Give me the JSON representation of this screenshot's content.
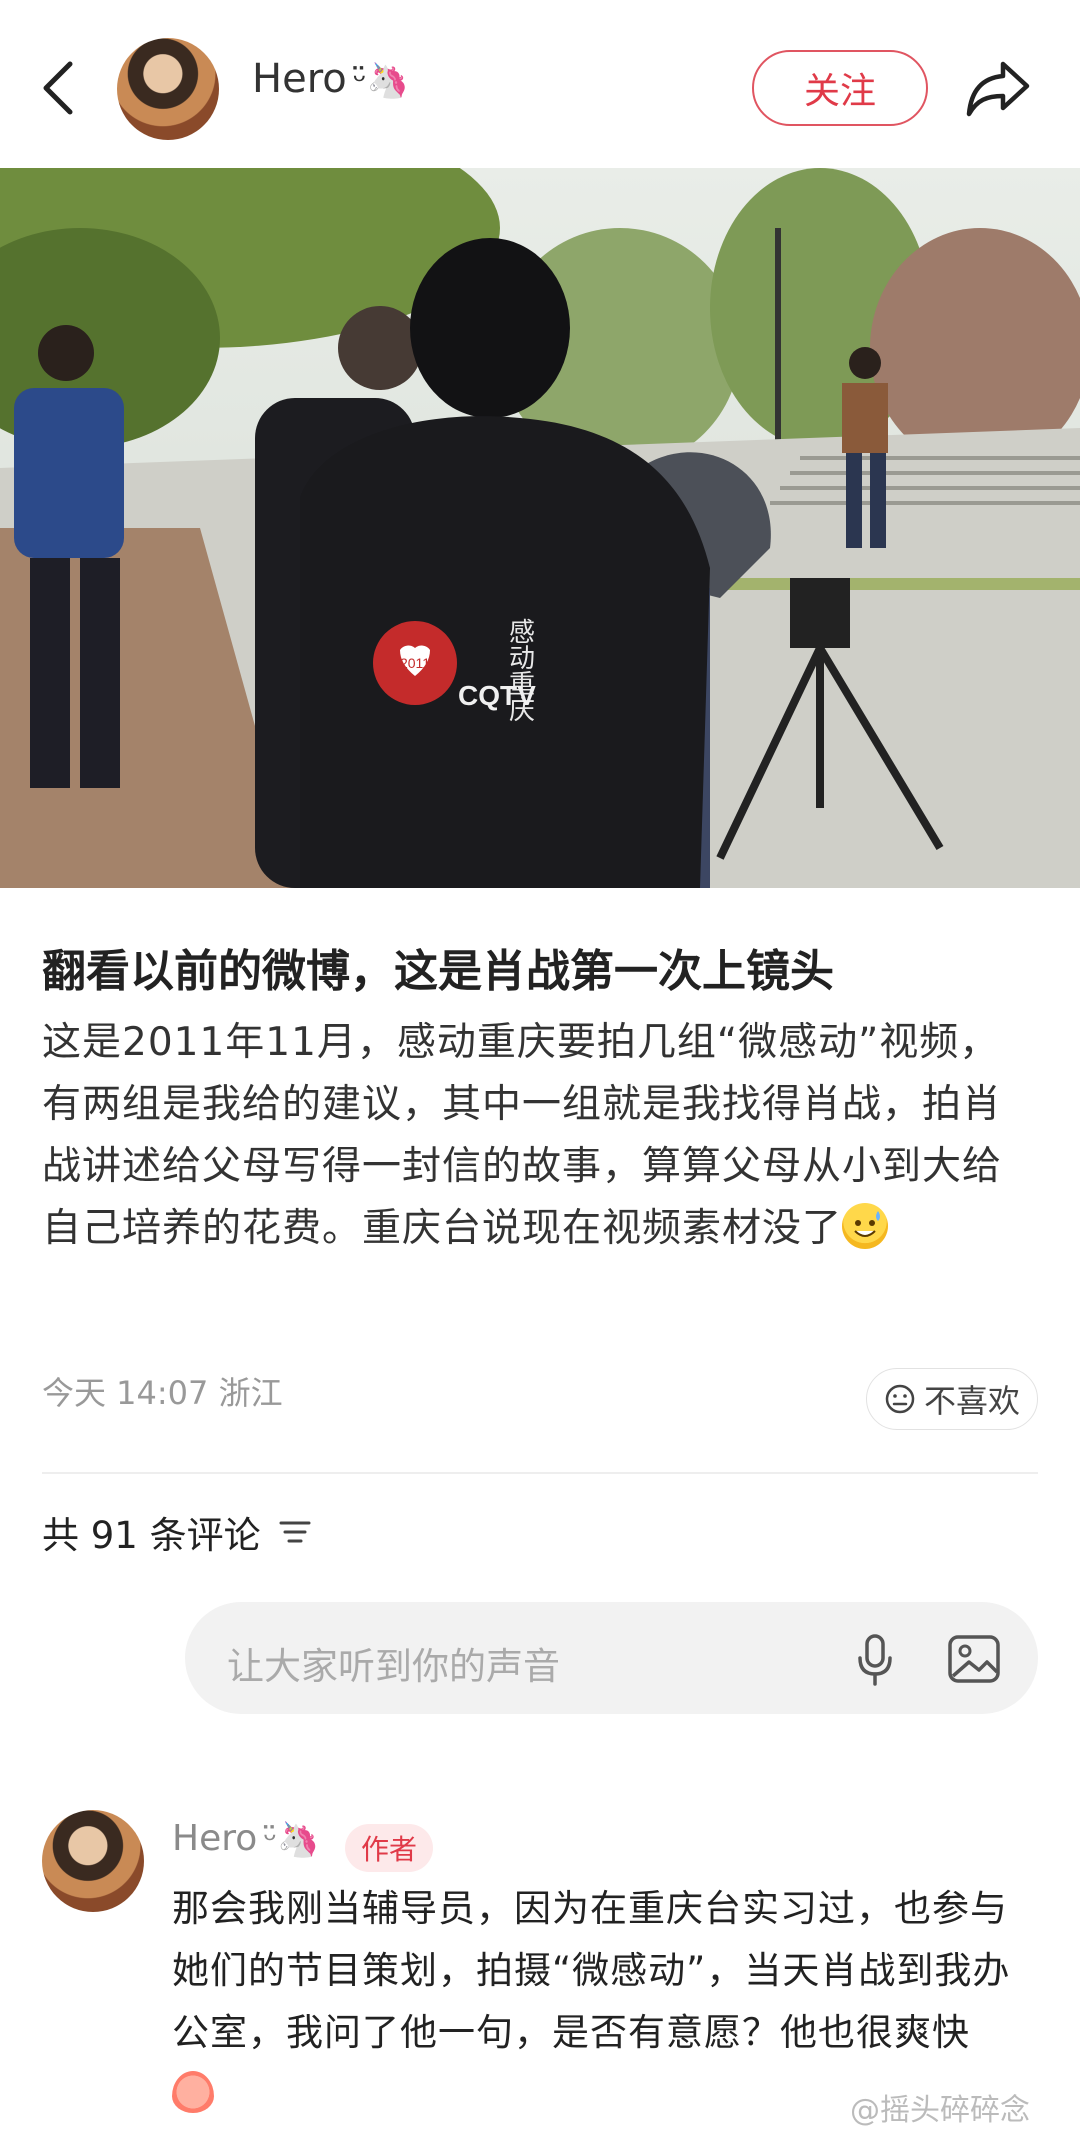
{
  "header": {
    "author_name": "Hero",
    "author_name_deco": "ᵕ̈🦄",
    "follow_label": "关注"
  },
  "photo": {
    "jacket_logo_year": "2011",
    "jacket_text": "CQTV",
    "jacket_calligraphy": "感动重庆"
  },
  "post": {
    "title": "翻看以前的微博，这是肖战第一次上镜头",
    "body": "这是2011年11月，感动重庆要拍几组“微感动”视频，有两组是我给的建议，其中一组就是我找得肖战，拍肖战讲述给父母写得一封信的故事，算算父母从小到大给自己培养的花费。重庆台说现在视频素材没了",
    "emoji": "😅",
    "meta": "今天 14:07 浙江",
    "dislike_label": "不喜欢"
  },
  "comments_section": {
    "count_label": "共 91 条评论",
    "input_placeholder": "让大家听到你的声音"
  },
  "comment": {
    "author_name": "Hero",
    "author_badge": "作者",
    "text": "那会我刚当辅导员，因为在重庆台实习过，也参与她们的节目策划，拍摄“微感动”，当天肖战到我办公室，我问了他一句，是否有意愿？他也很爽快"
  },
  "watermark": "@摇头碎碎念",
  "colors": {
    "accent": "#e03a48",
    "badge_bg": "#fde9ea",
    "input_bg": "#f2f2f2"
  }
}
